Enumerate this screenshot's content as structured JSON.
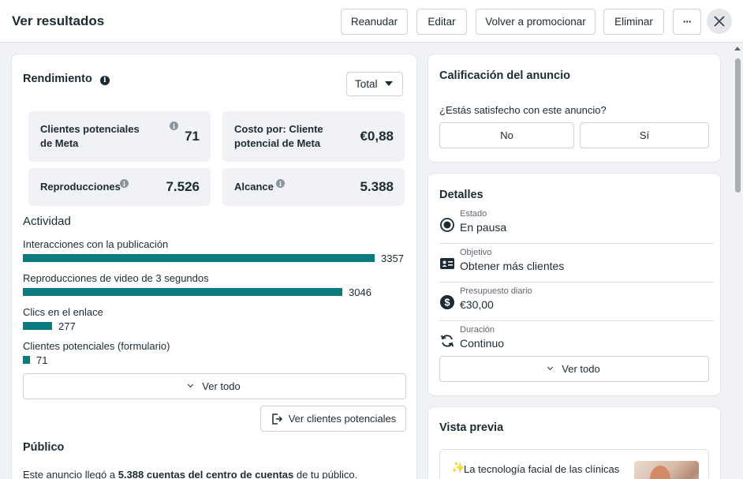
{
  "header": {
    "title": "Ver resultados",
    "buttons": {
      "resume": "Reanudar",
      "edit": "Editar",
      "promote_again": "Volver a promocionar",
      "delete": "Eliminar",
      "more": "···"
    }
  },
  "performance": {
    "title": "Rendimiento",
    "info_icon": "info-icon",
    "filter": "Total",
    "metrics": [
      {
        "label": "Clientes potenciales de Meta",
        "value": "71"
      },
      {
        "label": "Costo por: Cliente potencial de Meta",
        "value": "€0,88"
      },
      {
        "label": "Reproducciones",
        "value": "7.526"
      },
      {
        "label": "Alcance",
        "value": "5.388"
      }
    ]
  },
  "activity": {
    "title": "Actividad",
    "bar_color": "#0a7b7e",
    "items": [
      {
        "label": "Interacciones con la publicación",
        "value": 3357,
        "value_text": "3357"
      },
      {
        "label": "Reproducciones de video de 3 segundos",
        "value": 3046,
        "value_text": "3046"
      },
      {
        "label": "Clics en el enlace",
        "value": 277,
        "value_text": "277"
      },
      {
        "label": "Clientes potenciales (formulario)",
        "value": 71,
        "value_text": "71"
      }
    ],
    "see_all": "Ver todo",
    "see_leads": "Ver clientes potenciales"
  },
  "audience": {
    "title": "Público",
    "text_before": "Este anuncio llegó a ",
    "text_bold": "5.388 cuentas del centro de cuentas",
    "text_after": " de tu público."
  },
  "rating": {
    "title": "Calificación del anuncio",
    "question": "¿Estás satisfecho con este anuncio?",
    "no": "No",
    "yes": "Sí"
  },
  "details": {
    "title": "Detalles",
    "rows": [
      {
        "label": "Estado",
        "value": "En pausa",
        "icon": "radio-status-icon"
      },
      {
        "label": "Objetivo",
        "value": "Obtener más clientes",
        "icon": "id-card-icon"
      },
      {
        "label": "Presupuesto diario",
        "value": "€30,00",
        "icon": "dollar-circle-icon"
      },
      {
        "label": "Duración",
        "value": "Continuo",
        "icon": "refresh-icon"
      }
    ],
    "see_all": "Ver todo"
  },
  "preview": {
    "title": "Vista previa",
    "text": "La tecnología facial de las clínicas",
    "sparkle": "✨"
  }
}
